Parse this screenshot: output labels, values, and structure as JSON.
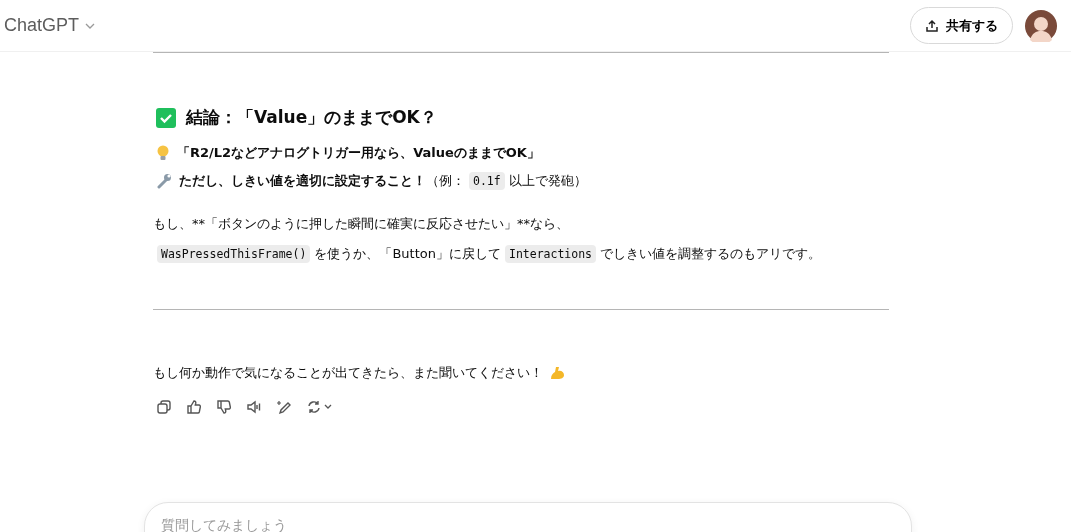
{
  "header": {
    "title": "ChatGPT",
    "share_button": "共有する"
  },
  "heading": "結論：「Value」のままでOK？",
  "points": [
    {
      "kind": "bulb",
      "parts": [
        {
          "kind": "bold",
          "text": "「R2/L2などアナログトリガー用なら、ValueのままでOK」"
        }
      ]
    },
    {
      "kind": "wrench",
      "parts": [
        {
          "kind": "bold",
          "text": "ただし、しきい値を適切に設定すること！"
        },
        {
          "kind": "text",
          "text": "（例："
        },
        {
          "kind": "code",
          "text": "0.1f"
        },
        {
          "kind": "text",
          "text": "以上で発砲）"
        }
      ]
    }
  ],
  "paragraph": [
    [
      {
        "kind": "text",
        "text": "もし、**「ボタンのように押した瞬間に確実に反応させたい」**なら、"
      }
    ],
    [
      {
        "kind": "code",
        "text": "WasPressedThisFrame()"
      },
      {
        "kind": "text",
        "text": "を使うか、「Button」に戻して"
      },
      {
        "kind": "code",
        "text": "Interactions"
      },
      {
        "kind": "text",
        "text": "でしきい値を調整するのもアリです。"
      }
    ]
  ],
  "closing": "もし何か動作で気になることが出てきたら、また聞いてください！",
  "actions": [
    {
      "kind": "copy"
    },
    {
      "kind": "like"
    },
    {
      "kind": "dislike"
    },
    {
      "kind": "speaker"
    },
    {
      "kind": "edit"
    },
    {
      "kind": "regenerate"
    }
  ],
  "composer": {
    "placeholder": "質問してみましょう"
  }
}
